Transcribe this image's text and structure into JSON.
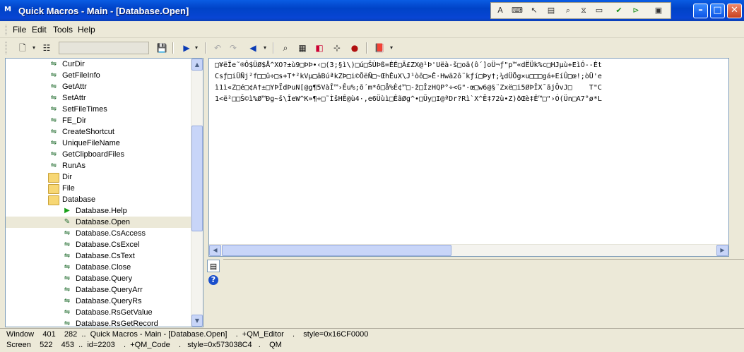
{
  "window": {
    "title": "Quick Macros - Main - [Database.Open]",
    "app_icon_text": "M"
  },
  "title_toolbar": {
    "icons": [
      "keyboard-text-icon",
      "keyboard-icon",
      "mouse-icon",
      "window-icon",
      "find-icon",
      "hourglass-icon",
      "dialog-icon",
      "check-icon",
      "debug-icon",
      "window-select-icon"
    ]
  },
  "menu": {
    "items": [
      "File",
      "Edit",
      "Tools",
      "Help"
    ]
  },
  "toolbar": {
    "combo_value": ""
  },
  "tree": {
    "items": [
      {
        "label": "CurDir",
        "icon": "function"
      },
      {
        "label": "GetFileInfo",
        "icon": "function"
      },
      {
        "label": "GetAttr",
        "icon": "function"
      },
      {
        "label": "SetAttr",
        "icon": "function"
      },
      {
        "label": "SetFileTimes",
        "icon": "function"
      },
      {
        "label": "FE_Dir",
        "icon": "function"
      },
      {
        "label": "CreateShortcut",
        "icon": "function"
      },
      {
        "label": "UniqueFileName",
        "icon": "function"
      },
      {
        "label": "GetClipboardFiles",
        "icon": "function"
      },
      {
        "label": "RunAs",
        "icon": "function"
      },
      {
        "label": "Dir",
        "icon": "folder"
      },
      {
        "label": "File",
        "icon": "folder"
      },
      {
        "label": "Database",
        "icon": "folder-open"
      },
      {
        "label": "Database.Help",
        "icon": "macro"
      },
      {
        "label": "Database.Open",
        "icon": "function-edit"
      },
      {
        "label": "Database.CsAccess",
        "icon": "function"
      },
      {
        "label": "Database.CsExcel",
        "icon": "function"
      },
      {
        "label": "Database.CsText",
        "icon": "function"
      },
      {
        "label": "Database.Close",
        "icon": "function"
      },
      {
        "label": "Database.Query",
        "icon": "function"
      },
      {
        "label": "Database.QueryArr",
        "icon": "function"
      },
      {
        "label": "Database.QueryRs",
        "icon": "function"
      },
      {
        "label": "Database.RsGetValue",
        "icon": "function"
      },
      {
        "label": "Database.RsGetRecord",
        "icon": "function"
      }
    ],
    "selected": "Database.Open"
  },
  "editor": {
    "lines": [
      "□¥ëÏe˜®Ô$ÜØ$Å^XO?±ù9□ÞÞ•‹□(3;§ì\\)□ú□ŠÙÞß=ÉÉ□Ä£ZX@¹Þ'Uëà-š□oä(ô´]oÜ¬ƒ\"p™«dËÜk%c□HJµù+EìÓ--Èt",
      "Csƒ□iÜÑj²f□□û÷□s+T*²kVµ□äBúªkZÞ□i©ÕëÑ□~ŒhÊuX\\J¹òô□»Ê·Hwä2ô¨kƒí□Þy†;¼dÜÕg×u□□□gá+EíÛ□œ!;òÜ'e",
      "ì1ì«Z□é□¢A†±□YÞÏdÞuN[@g¶5VàÎ™›Êu%;õ´m*ô□å%È¢™□-ž□ÎzHQP°÷<G\"-œ□w6@§¨Zxë□i5ØÞÎX¯ãjÔvJ□    T\"C",
      "1<ë²□□Š©ì%Ø™Ðg~š\\ÎeW^K»¶÷□˜ÌšHÊ@ù4·,e6Üùì□ÊãØg^•□Üy□I@ªDr?Rì`X^Ë‡72ù•Z)ðŒè‡Ê™□\"›Ó(Ün□A7°ø*L"
    ]
  },
  "status": {
    "line1": "Window    401    282  ..  Quick Macros - Main - [Database.Open]    .  +QM_Editor    .    style=0x16CF0000",
    "line2": "Screen    522    453  ..  id=2203    .  +QM_Code    .   style=0x573038C4   .    QM"
  }
}
